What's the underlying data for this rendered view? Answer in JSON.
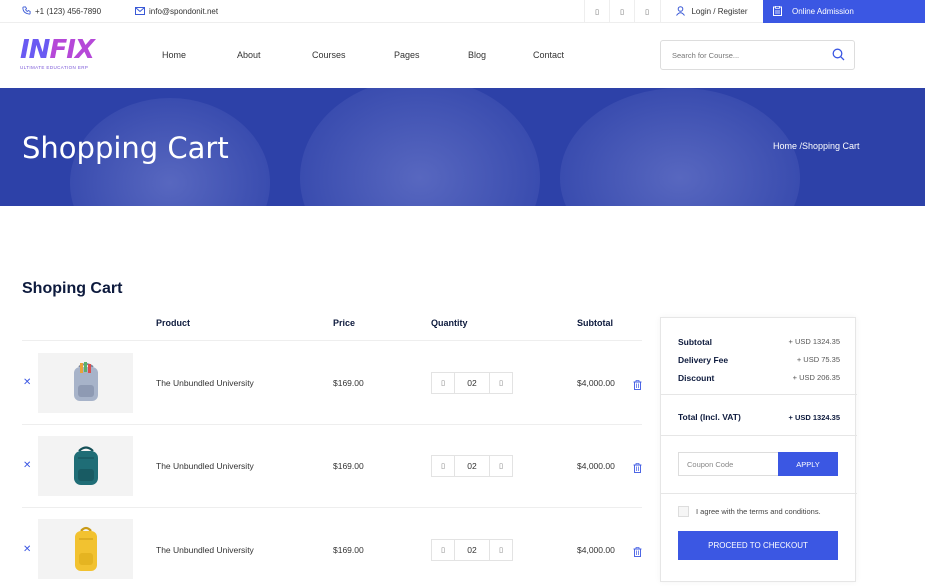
{
  "topbar": {
    "phone": "+1 (123) 456-7890",
    "email": "info@spondonit.net",
    "social_icons": [
      "facebook-icon",
      "twitter-icon",
      "instagram-icon"
    ],
    "login_label": "Login / Register",
    "admission_label": "Online Admission"
  },
  "header": {
    "logo_text": "INFIX",
    "logo_tagline": "ULTIMATE EDUCATION ERP",
    "nav": [
      "Home",
      "About",
      "Courses",
      "Pages",
      "Blog",
      "Contact"
    ],
    "search_placeholder": "Search for Course..."
  },
  "banner": {
    "title": "Shopping Cart",
    "breadcrumb": "Home /Shopping Cart"
  },
  "cart": {
    "title": "Shoping Cart",
    "columns": [
      "Product",
      "Price",
      "Quantity",
      "Subtotal"
    ],
    "items": [
      {
        "name": "The Unbundled University",
        "price": "$169.00",
        "qty": "02",
        "subtotal": "$4,000.00",
        "bag_color": "#a7b3c9"
      },
      {
        "name": "The Unbundled University",
        "price": "$169.00",
        "qty": "02",
        "subtotal": "$4,000.00",
        "bag_color": "#1f6d76"
      },
      {
        "name": "The Unbundled University",
        "price": "$169.00",
        "qty": "02",
        "subtotal": "$4,000.00",
        "bag_color": "#f2c230"
      }
    ]
  },
  "summary": {
    "subtotal_label": "Subtotal",
    "subtotal_value": "+ USD 1324.35",
    "delivery_label": "Delivery Fee",
    "delivery_value": "+ USD 75.35",
    "discount_label": "Discount",
    "discount_value": "+ USD 206.35",
    "total_label": "Total (Incl. VAT)",
    "total_value": "+ USD 1324.35",
    "coupon_placeholder": "Coupon Code",
    "apply_label": "APPLY",
    "terms_label": "I agree with the terms and conditions.",
    "checkout_label": "PROCEED TO CHECKOUT"
  },
  "colors": {
    "accent": "#3b57e3",
    "banner": "#2d41a8",
    "heading": "#0d1a3d"
  }
}
